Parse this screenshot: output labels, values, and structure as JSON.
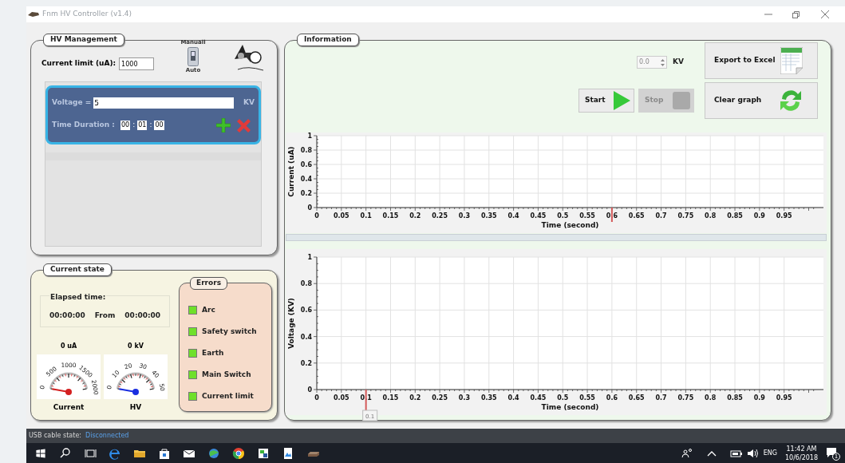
{
  "window": {
    "title": "Fnm HV Controller (v1.4)"
  },
  "hv_management": {
    "title": "HV Management",
    "current_limit": {
      "label": "Current limit (uA):",
      "value": "1000"
    },
    "mode_switch": {
      "top_label": "Manuall",
      "bottom_label": "Auto"
    },
    "steps": [
      {
        "voltage_label": "Voltage =",
        "voltage": "5",
        "unit": "KV",
        "duration_label": "Time Duration :",
        "hours": "00",
        "separators": [
          ":",
          ":"
        ],
        "minutes": "01",
        "seconds": "00",
        "selected": true
      }
    ]
  },
  "current_state": {
    "title": "Current state",
    "elapsed_label": "Elapsed time:",
    "elapsed": "00:00:00",
    "from_label": "From",
    "total": "00:00:00",
    "gauges": [
      {
        "reading": "0 uA",
        "label": "Current",
        "ticks": [
          "0",
          "500",
          "1000",
          "1500",
          "2000"
        ],
        "color": "#d42020"
      },
      {
        "reading": "0 kV",
        "label": "HV",
        "ticks": [
          "0",
          "10",
          "20",
          "30",
          "40",
          "50"
        ],
        "color": "#1a2ee0"
      }
    ],
    "errors": {
      "title": "Errors",
      "items": [
        {
          "label": "Arc",
          "ok": true
        },
        {
          "label": "Safety switch",
          "ok": true
        },
        {
          "label": "Earth",
          "ok": true
        },
        {
          "label": "Main Switch",
          "ok": true
        },
        {
          "label": "Current limit",
          "ok": true
        }
      ]
    }
  },
  "information": {
    "title": "Information",
    "spinner": {
      "value": "0.0",
      "unit": "KV"
    },
    "buttons": [
      {
        "kind": "start",
        "label": "Start",
        "disabled": false
      },
      {
        "kind": "stop",
        "label": "Stop",
        "disabled": true
      },
      {
        "kind": "export",
        "label": "Export to Excel",
        "disabled": false
      },
      {
        "kind": "clear",
        "label": "Clear graph",
        "disabled": false
      }
    ],
    "charts": [
      {
        "cursor": {
          "level": 0.5825
        },
        "chart_data": {
          "type": "line",
          "grid": true,
          "xlabel": "Time (second)",
          "ylabel": "Current (uA)",
          "xlim": [
            0,
            1.03
          ],
          "ylim": [
            0,
            1
          ],
          "xticks": [
            0,
            0.05,
            0.1,
            0.15,
            0.2,
            0.25,
            0.3,
            0.35,
            0.4,
            0.45,
            0.5,
            0.55,
            0.6,
            0.65,
            0.7,
            0.75,
            0.8,
            0.85,
            0.9,
            0.95
          ],
          "yticks": [
            0,
            0.2,
            0.4,
            0.6,
            0.8,
            1
          ]
        }
      },
      {
        "cursor": {
          "level": 0.0971,
          "label": "0.1"
        },
        "chart_data": {
          "type": "line",
          "grid": true,
          "xlabel": "Time (second)",
          "ylabel": "Voltage (KV)",
          "xlim": [
            0,
            1.03
          ],
          "ylim": [
            0,
            1
          ],
          "xticks": [
            0,
            0.05,
            0.1,
            0.15,
            0.2,
            0.25,
            0.3,
            0.35,
            0.4,
            0.45,
            0.5,
            0.55,
            0.6,
            0.65,
            0.7,
            0.75,
            0.8,
            0.85,
            0.9,
            0.95
          ],
          "yticks": [
            0,
            0.2,
            0.4,
            0.6,
            0.8,
            1
          ]
        }
      }
    ]
  },
  "status_bar": {
    "label": "USB cable state:",
    "value": "Disconnected"
  },
  "taskbar": {
    "language": "ENG",
    "time": "11:42 AM",
    "date": "10/6/2018",
    "notifications": "1"
  }
}
